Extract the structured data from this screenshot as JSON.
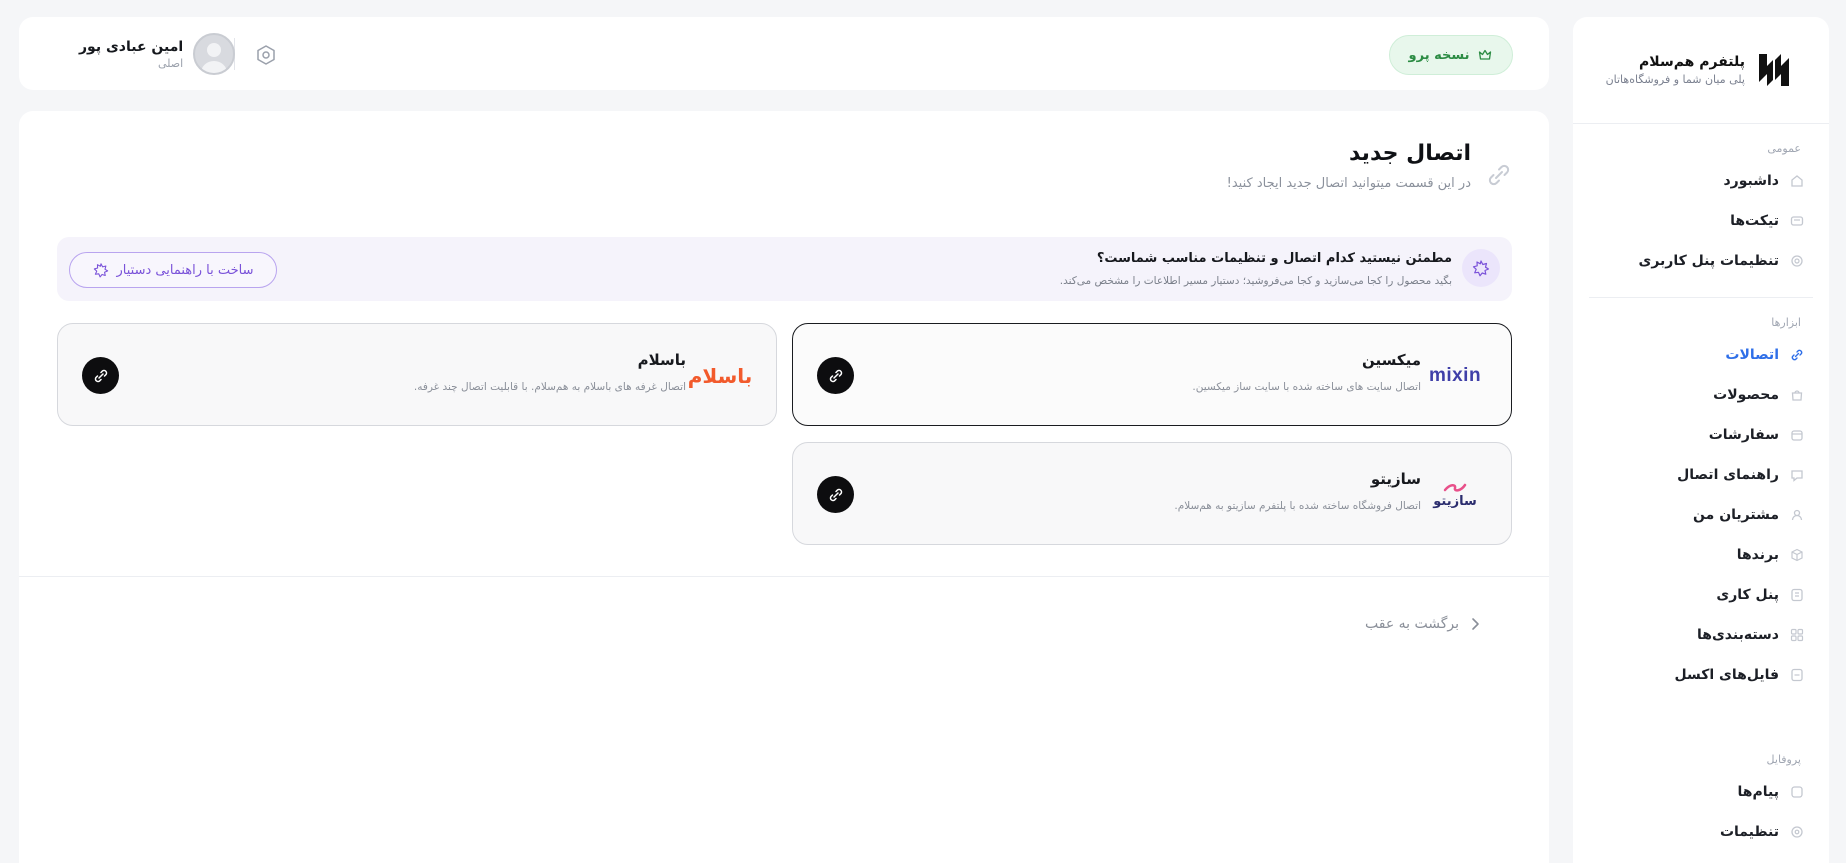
{
  "brand": {
    "title": "پلتفرم هم‌سلام",
    "subtitle": "پلی میان شما و فروشگاه‌هاتان"
  },
  "sidebar": {
    "sections": [
      {
        "title": "عمومی",
        "items": [
          {
            "label": "داشبورد",
            "icon": "home-icon"
          },
          {
            "label": "تیکت‌ها",
            "icon": "ticket-icon"
          },
          {
            "label": "تنظیمات پنل کاربری",
            "icon": "gear-icon"
          }
        ]
      },
      {
        "title": "ابزارها",
        "items": [
          {
            "label": "اتصالات",
            "icon": "link-icon",
            "active": true
          },
          {
            "label": "محصولات",
            "icon": "bag-icon"
          },
          {
            "label": "سفارشات",
            "icon": "cart-icon"
          },
          {
            "label": "راهنمای اتصال",
            "icon": "help-icon"
          },
          {
            "label": "مشتریان من",
            "icon": "user-icon"
          },
          {
            "label": "برندها",
            "icon": "box-icon"
          },
          {
            "label": "پنل کاری",
            "icon": "panel-icon"
          },
          {
            "label": "دسته‌بندی‌ها",
            "icon": "grid-icon"
          },
          {
            "label": "فایل‌های اکسل",
            "icon": "file-icon"
          }
        ]
      },
      {
        "title": "پروفایل",
        "items": [
          {
            "label": "پیام‌ها",
            "icon": "message-icon"
          },
          {
            "label": "تنظیمات",
            "icon": "settings-icon"
          }
        ]
      }
    ]
  },
  "topbar": {
    "pro_label": "نسخه پرو",
    "user_name": "امین عبادی پور",
    "user_role": "اصلی"
  },
  "page": {
    "title": "اتصال جدید",
    "subtitle": "در این قسمت میتوانید اتصال جدید ایجاد کنید!"
  },
  "hint": {
    "title": "مطمئن نیستید کدام اتصال و تنظیمات مناسب شماست؟",
    "description": "بگید محصول را کجا می‌سازید و کجا می‌فروشید؛ دستیار مسیر اطلاعات را مشخص می‌کند.",
    "button_label": "ساخت با راهنمایی دستیار"
  },
  "connections": [
    {
      "name": "میکسین",
      "description": "اتصال سایت های ساخته شده با سایت ساز میکسین.",
      "logo_text": "mixin",
      "logo_color": "#3f3fa8"
    },
    {
      "name": "باسلام",
      "description": "اتصال غرفه های باسلام به هم‌سلام. با قابلیت اتصال چند غرفه.",
      "logo_text": "باسلام",
      "logo_color": "#f25a2c"
    },
    {
      "name": "سازیتو",
      "description": "اتصال فروشگاه ساخته شده با پلتفرم سازیتو به هم‌سلام.",
      "logo_text": "سازیتو",
      "logo_color": "#2b2d6e"
    }
  ],
  "back_label": "برگشت به عقب",
  "colors": {
    "accent": "#2f6fe8",
    "pro_green": "#2c8c44",
    "assistant_purple": "#7a52d9"
  }
}
